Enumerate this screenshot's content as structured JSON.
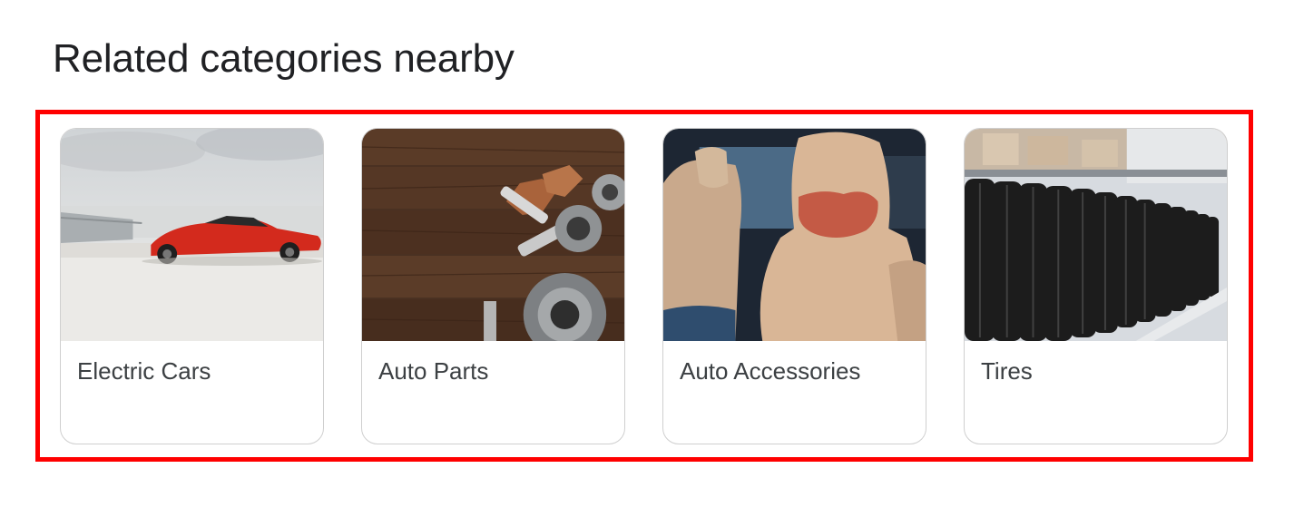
{
  "section": {
    "title": "Related categories nearby"
  },
  "categories": [
    {
      "label": "Electric Cars",
      "image": "red-electric-sports-car"
    },
    {
      "label": "Auto Parts",
      "image": "spark-plugs-and-bearings-on-wood"
    },
    {
      "label": "Auto Accessories",
      "image": "beige-car-seats-with-neck-pillow"
    },
    {
      "label": "Tires",
      "image": "rows-of-tires-on-shelf"
    }
  ],
  "colors": {
    "highlight_border": "#ff0000",
    "card_border": "#cfcfcf",
    "title_text": "#202124",
    "label_text": "#3c4043"
  }
}
